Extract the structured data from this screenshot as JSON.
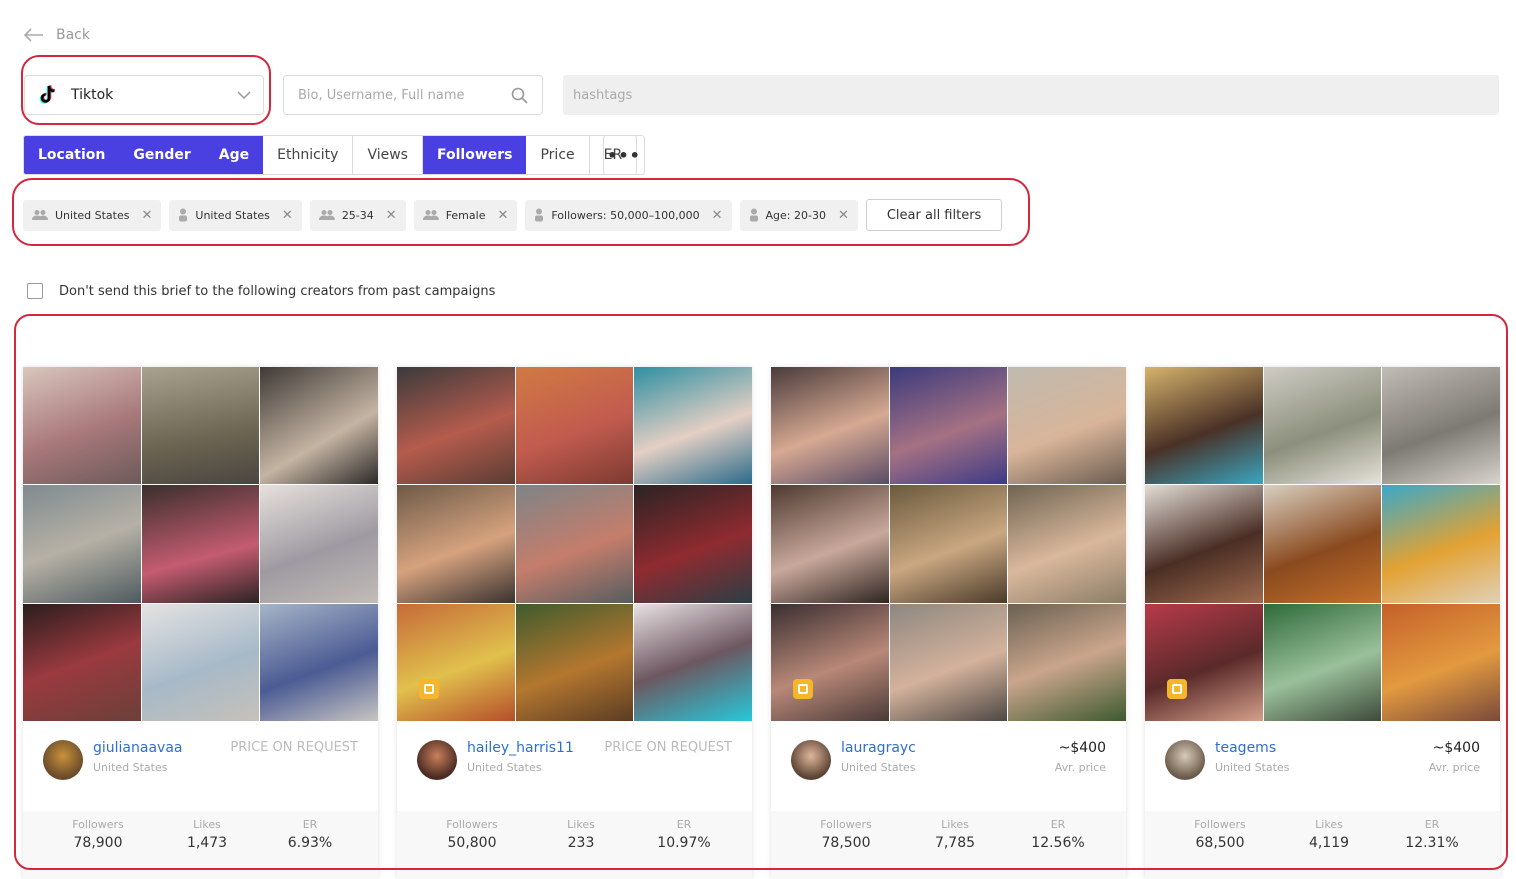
{
  "nav": {
    "back_label": "Back"
  },
  "platform": {
    "value": "Tiktok"
  },
  "search": {
    "placeholder": "Bio, Username, Full name"
  },
  "hashtags": {
    "placeholder": "hashtags"
  },
  "filter_bar": [
    {
      "label": "Location",
      "active": true
    },
    {
      "label": "Gender",
      "active": true
    },
    {
      "label": "Age",
      "active": true
    },
    {
      "label": "Ethnicity",
      "active": false
    },
    {
      "label": "Views",
      "active": false
    },
    {
      "label": "Followers",
      "active": true
    },
    {
      "label": "Price",
      "active": false
    },
    {
      "label": "ER",
      "active": false
    }
  ],
  "more_label": "•••",
  "active_filters": [
    {
      "icon": "users-icon",
      "label": "United States"
    },
    {
      "icon": "user-icon",
      "label": "United States"
    },
    {
      "icon": "users-icon",
      "label": "25-34"
    },
    {
      "icon": "users-icon",
      "label": "Female"
    },
    {
      "icon": "user-icon",
      "label": "Followers: 50,000–100,000"
    },
    {
      "icon": "user-icon",
      "label": "Age: 20-30"
    }
  ],
  "clear_all_label": "Clear all filters",
  "exclude_label": "Don't send this brief to the following creators from past campaigns",
  "stat_labels": {
    "followers": "Followers",
    "likes": "Likes",
    "er": "ER"
  },
  "colors": {
    "accent": "#4a3fe0",
    "link": "#2e6fcf",
    "highlight": "#d4263c"
  },
  "creators": [
    {
      "username": "giulianaavaa",
      "country": "United States",
      "price": "PRICE ON REQUEST",
      "price_label": "",
      "followers": "78,900",
      "likes": "1,473",
      "er": "6.93%",
      "has_badge": false
    },
    {
      "username": "hailey_harris11",
      "country": "United States",
      "price": "PRICE ON REQUEST",
      "price_label": "",
      "followers": "50,800",
      "likes": "233",
      "er": "10.97%",
      "has_badge": true
    },
    {
      "username": "lauragrayc",
      "country": "United States",
      "price": "~$400",
      "price_label": "Avr. price",
      "followers": "78,500",
      "likes": "7,785",
      "er": "12.56%",
      "has_badge": true
    },
    {
      "username": "teagems",
      "country": "United States",
      "price": "~$400",
      "price_label": "Avr. price",
      "followers": "68,500",
      "likes": "4,119",
      "er": "12.31%",
      "has_badge": true
    }
  ]
}
